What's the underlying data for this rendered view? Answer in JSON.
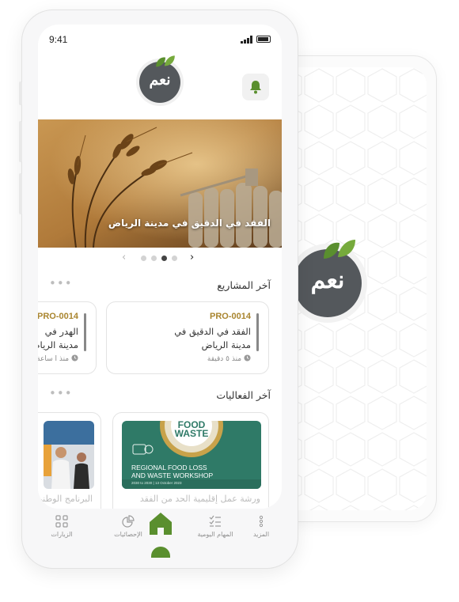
{
  "status_bar": {
    "time": "9:41"
  },
  "app": {
    "logo_text": "نعم",
    "brand_color": "#5a8f2e",
    "gold_color": "#a9852f"
  },
  "header": {
    "bell_icon": "bell-icon"
  },
  "hero": {
    "caption": "الفقد في الدقيق  في مدينة الرياض",
    "slides_total": 4,
    "active_slide": 3
  },
  "projects": {
    "title": "آخر المشاريع",
    "items": [
      {
        "code": "PRO-0014",
        "title": "الفقد في الدقيق  في مدينة الرياض",
        "time": "منذ ٥ دقيقة"
      },
      {
        "code": "PRO-0014",
        "title": "الهدر في مدينة الرياض",
        "time": "منذ ا ساعة"
      }
    ]
  },
  "events": {
    "title": "آخر الفعاليات",
    "items": [
      {
        "title": "ورشة عمل إقليمية الحد من الفقد",
        "poster": {
          "food": "FOOD",
          "waste": "WASTE",
          "regional": "REGIONAL FOOD LOSS",
          "workshop": "AND WASTE WORKSHOP",
          "date": "2030 to 2030 | 13 October 2023"
        }
      },
      {
        "title": "البرنامج الوطني"
      }
    ]
  },
  "tabbar": {
    "tabs": [
      {
        "label": "المزيد",
        "icon": "more-icon"
      },
      {
        "label": "المهام اليومية",
        "icon": "tasks-icon"
      },
      {
        "label": "الرئيسية",
        "icon": "home-icon"
      },
      {
        "label": "الإحصائيات",
        "icon": "stats-icon"
      },
      {
        "label": "الزيارات",
        "icon": "visits-icon"
      }
    ]
  }
}
